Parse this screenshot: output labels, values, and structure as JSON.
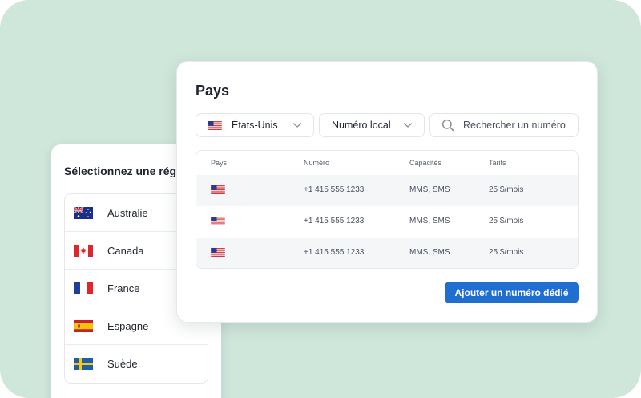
{
  "colors": {
    "background": "#cfe6db",
    "accent": "#1f6fd1",
    "row_shade": "#f4f6f8"
  },
  "region_card": {
    "title": "Sélectionnez une région",
    "items": [
      {
        "label": "Australie",
        "flag": "australia-flag-icon"
      },
      {
        "label": "Canada",
        "flag": "canada-flag-icon"
      },
      {
        "label": "France",
        "flag": "france-flag-icon"
      },
      {
        "label": "Espagne",
        "flag": "spain-flag-icon"
      },
      {
        "label": "Suède",
        "flag": "sweden-flag-icon"
      }
    ]
  },
  "panel": {
    "title": "Pays",
    "country_select": {
      "value": "États-Unis",
      "flag": "us-flag-icon"
    },
    "type_select": {
      "value": "Numéro local"
    },
    "search": {
      "placeholder": "Rechercher un numéro",
      "icon": "search-icon"
    },
    "table": {
      "headers": [
        "Pays",
        "Numéro",
        "Capacités",
        "Tarifs"
      ],
      "rows": [
        {
          "flag": "us-flag-icon",
          "number": "+1 415 555 1233",
          "capabilities": "MMS, SMS",
          "rate": "25 $/mois"
        },
        {
          "flag": "us-flag-icon",
          "number": "+1 415 555 1233",
          "capabilities": "MMS, SMS",
          "rate": "25 $/mois"
        },
        {
          "flag": "us-flag-icon",
          "number": "+1 415 555 1233",
          "capabilities": "MMS, SMS",
          "rate": "25 $/mois"
        }
      ]
    },
    "add_button": "Ajouter un numéro dédié"
  }
}
